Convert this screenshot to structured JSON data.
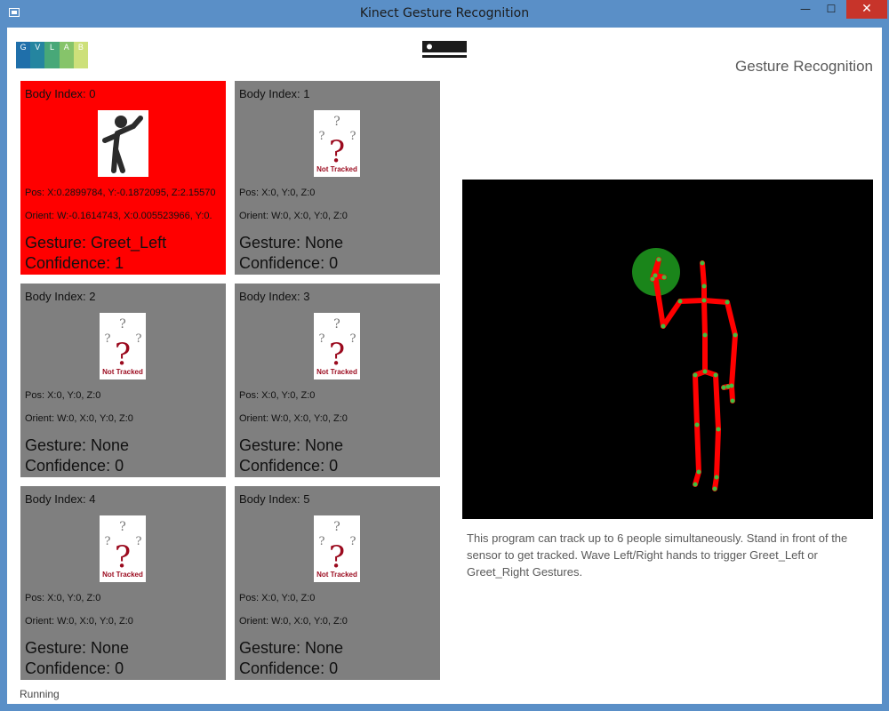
{
  "window": {
    "title": "Kinect Gesture Recognition",
    "minimize_glyph": "—",
    "maximize_glyph": "☐",
    "close_glyph": "✕",
    "accent_color": "#5a8fc7",
    "close_color": "#c7342a"
  },
  "logo": {
    "letters": [
      "G",
      "V",
      "L",
      "A",
      "B"
    ],
    "colors": [
      "#1f6faa",
      "#2585a0",
      "#48a878",
      "#86c46a",
      "#cde07a"
    ]
  },
  "header": {
    "title": "Gesture Recognition",
    "sensor_icon": "kinect-sensor-icon"
  },
  "bodies": [
    {
      "index": "Body Index: 0",
      "pos": "Pos: X:0.2899784, Y:-0.1872095, Z:2.15570",
      "orient": "Orient: W:-0.1614743, X:0.005523966, Y:0.",
      "gesture": "Gesture: Greet_Left",
      "confidence": "Confidence: 1",
      "tracked": true,
      "color": "#ff0000"
    },
    {
      "index": "Body Index: 1",
      "pos": "Pos: X:0, Y:0, Z:0",
      "orient": "Orient: W:0, X:0, Y:0, Z:0",
      "gesture": "Gesture: None",
      "confidence": "Confidence: 0",
      "tracked": false,
      "color": "#7f7f7f"
    },
    {
      "index": "Body Index: 2",
      "pos": "Pos: X:0, Y:0, Z:0",
      "orient": "Orient: W:0, X:0, Y:0, Z:0",
      "gesture": "Gesture: None",
      "confidence": "Confidence: 0",
      "tracked": false,
      "color": "#7f7f7f"
    },
    {
      "index": "Body Index: 3",
      "pos": "Pos: X:0, Y:0, Z:0",
      "orient": "Orient: W:0, X:0, Y:0, Z:0",
      "gesture": "Gesture: None",
      "confidence": "Confidence: 0",
      "tracked": false,
      "color": "#7f7f7f"
    },
    {
      "index": "Body Index: 4",
      "pos": "Pos: X:0, Y:0, Z:0",
      "orient": "Orient: W:0, X:0, Y:0, Z:0",
      "gesture": "Gesture: None",
      "confidence": "Confidence: 0",
      "tracked": false,
      "color": "#7f7f7f"
    },
    {
      "index": "Body Index: 5",
      "pos": "Pos: X:0, Y:0, Z:0",
      "orient": "Orient: W:0, X:0, Y:0, Z:0",
      "gesture": "Gesture: None",
      "confidence": "Confidence: 0",
      "tracked": false,
      "color": "#7f7f7f"
    }
  ],
  "not_tracked_label": "Not Tracked",
  "skeleton": {
    "bone_color": "#ff0000",
    "joint_color": "#3fbf3f",
    "hand_state_color": "#1e9c1e"
  },
  "description": "This program can track up to 6 people simultaneously. Stand in front of the sensor to get tracked. Wave Left/Right hands to trigger Greet_Left or Greet_Right Gestures.",
  "status": "Running"
}
